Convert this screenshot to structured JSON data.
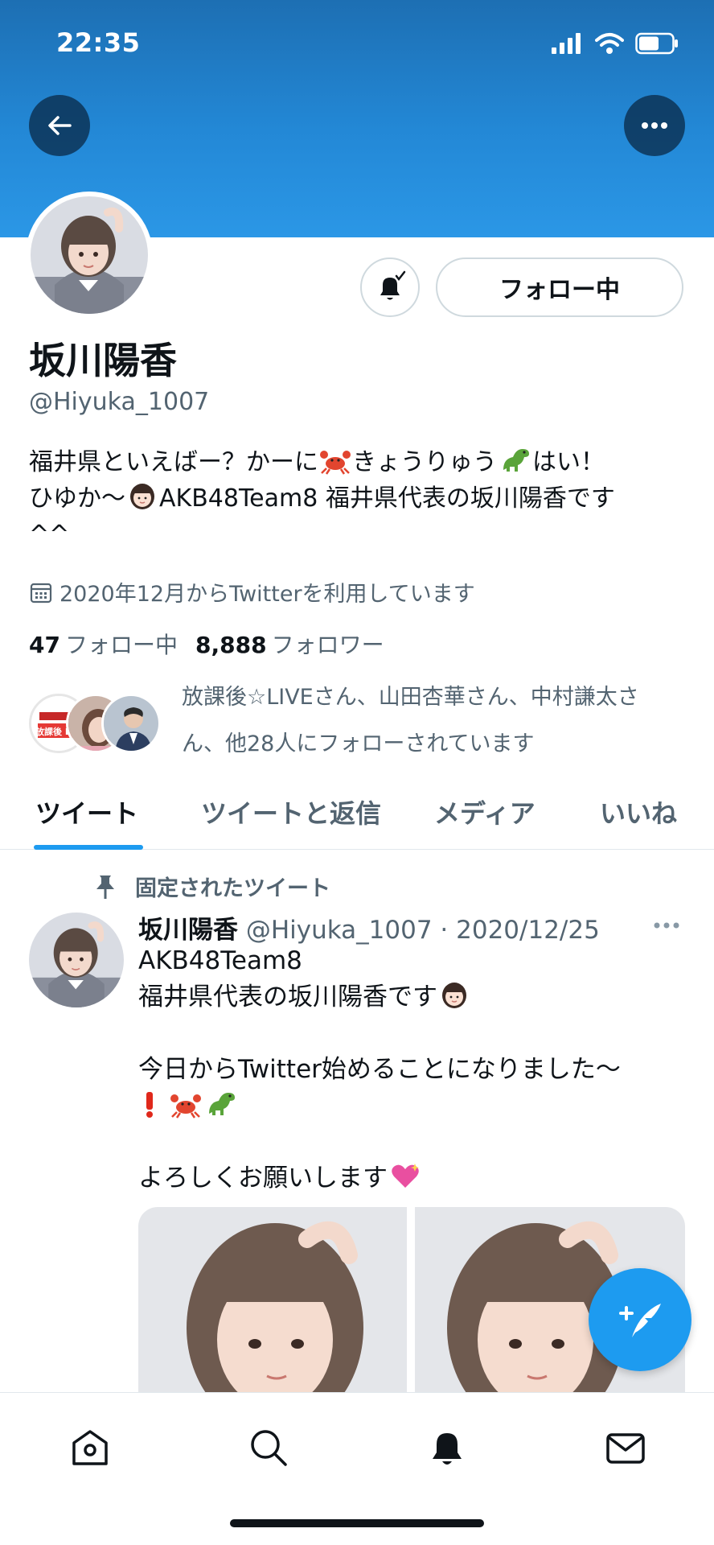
{
  "status_bar": {
    "time": "22:35"
  },
  "profile": {
    "display_name": "坂川陽香",
    "handle": "@Hiyuka_1007",
    "follow_button_label": "フォロー中",
    "bio_lines": [
      "福井県といえばー？かーに",
      "きょうりゅう",
      "はい！",
      "ひゆか〜",
      "AKB48Team8 福井県代表の坂川陽香です",
      "^^"
    ],
    "joined": "2020年12月からTwitterを利用しています",
    "following_count": "47",
    "following_label": "フォロー中",
    "followers_count": "8,888",
    "followers_label": "フォロワー",
    "followed_by_line1": "放課後☆LIVEさん、山田杏華さん、中村謙太さ",
    "followed_by_line2": "ん、他28人にフォローされています",
    "mini_avatar_text": "放課後 LIVE"
  },
  "tabs": [
    {
      "label": "ツイート",
      "active": true
    },
    {
      "label": "ツイートと返信",
      "active": false
    },
    {
      "label": "メディア",
      "active": false
    },
    {
      "label": "いいね",
      "active": false
    }
  ],
  "pinned_tweet": {
    "pinned_label": "固定されたツイート",
    "author_name": "坂川陽香",
    "author_meta": "@Hiyuka_1007 · 2020/12/25",
    "lines": [
      "AKB48Team8",
      "福井県代表の坂川陽香です",
      "",
      "今日からTwitter始めることになりました〜",
      "",
      "",
      "よろしくお願いします"
    ]
  },
  "icons": {
    "back": "arrow-left-icon",
    "more": "more-horizontal-icon",
    "bell": "bell-check-icon",
    "calendar": "calendar-icon",
    "pin": "pin-icon",
    "compose": "compose-tweet-icon",
    "home": "home-icon",
    "search": "search-icon",
    "notifications": "bell-icon",
    "messages": "mail-icon"
  },
  "colors": {
    "accent": "#1d9bf0",
    "banner": "#2388d6",
    "secondary_text": "#536471"
  }
}
